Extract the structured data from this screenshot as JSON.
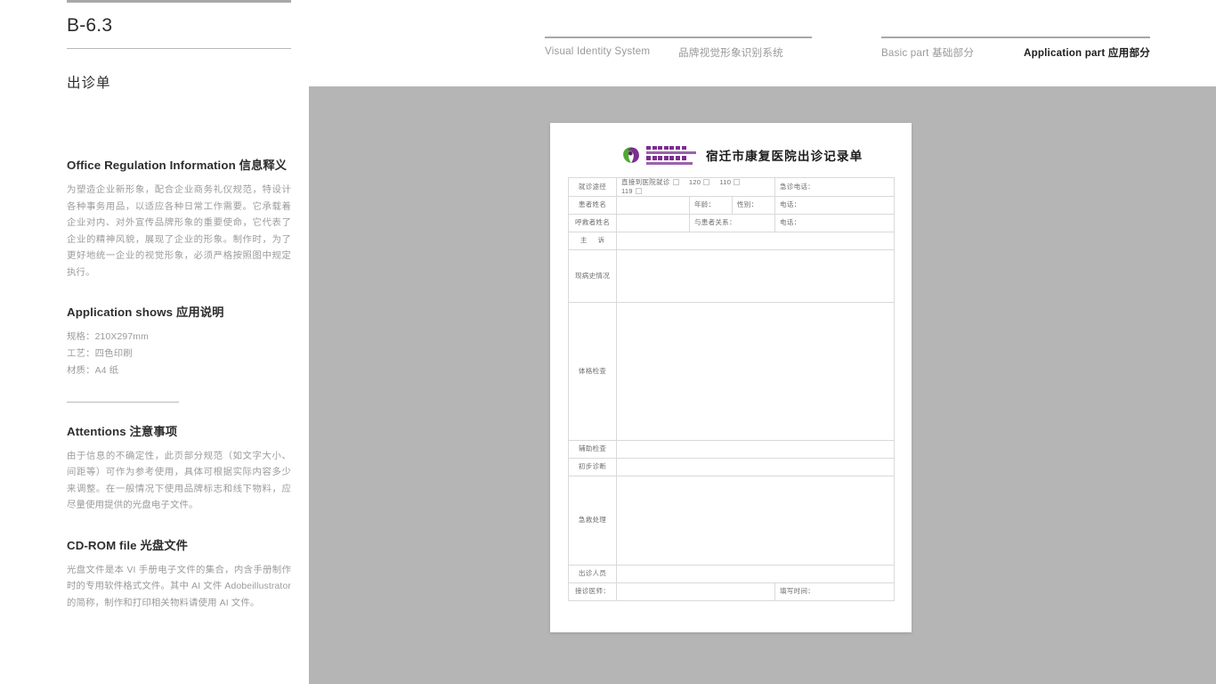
{
  "sidebar": {
    "code": "B-6.3",
    "doc_title": "出诊单",
    "sections": [
      {
        "heading": "Office Regulation Information 信息释义",
        "body": "为塑造企业新形象，配合企业商务礼仪规范，特设计各种事务用品，以适应各种日常工作需要。它承载着企业对内、对外宣传品牌形象的重要使命，它代表了企业的精神风貌，展现了企业的形象。制作时，为了更好地统一企业的视觉形象，必须严格按照图中规定执行。"
      },
      {
        "heading": "Application shows 应用说明",
        "specs": [
          "规格：210X297mm",
          "工艺：四色印刷",
          "材质：A4 纸"
        ]
      },
      {
        "heading": "Attentions 注意事项",
        "body": "由于信息的不确定性，此页部分规范（如文字大小、间距等）可作为参考使用，具体可根据实际内容多少来调整。在一般情况下使用品牌标志和线下物料，应尽量使用提供的光盘电子文件。"
      },
      {
        "heading": "CD-ROM file 光盘文件",
        "body": "光盘文件是本 VI 手册电子文件的集合，内含手册制作时的专用软件格式文件。其中 AI 文件 Adobeillustrator 的简称，制作和打印相关物料请使用 AI 文件。"
      }
    ]
  },
  "header": {
    "system_en": "Visual Identity System",
    "system_cn": "品牌视觉形象识别系统",
    "basic_part": "Basic part  基础部分",
    "application_part": "Application part  应用部分"
  },
  "document": {
    "title": "宿迁市康复医院出诊记录单",
    "logo_name": "hospital-logo",
    "rows": {
      "route_label": "就诊途径",
      "route_direct": "直接到医院就诊",
      "route_120": "120",
      "route_110": "110",
      "route_119": "119",
      "emergency_phone": "急诊电话：",
      "patient_name": "患者姓名",
      "age": "年龄：",
      "gender": "性别：",
      "phone": "电话：",
      "caller_name": "呼救者姓名",
      "relation": "与患者关系：",
      "caller_phone": "电话：",
      "chief_complaint": "主  诉",
      "history": "现病史情况",
      "physical_exam": "体格检查",
      "aux_exam": "辅助检查",
      "prelim_diagnosis": "初步诊断",
      "emergency_treatment": "急救处理",
      "staff": "出诊人员",
      "doctor": "接诊医师：",
      "fill_time": "填写时间："
    }
  },
  "colors": {
    "panel_gray": "#b5b5b5",
    "rule_gray": "#a8a8a8",
    "body_text": "#9b9b9b",
    "logo_purple": "#7a2f8f",
    "logo_green": "#4fa832"
  }
}
